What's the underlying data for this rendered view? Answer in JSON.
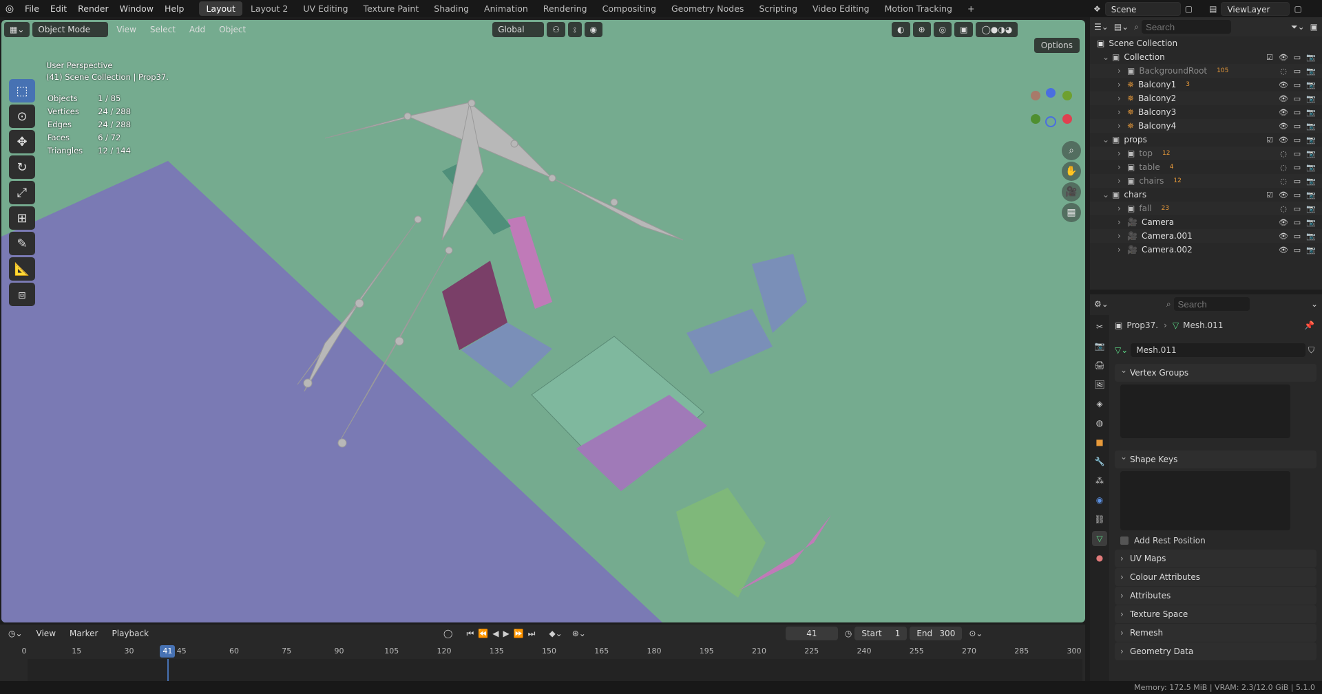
{
  "menu": [
    "File",
    "Edit",
    "Render",
    "Window",
    "Help"
  ],
  "workspaces": [
    "Layout",
    "Layout 2",
    "UV Editing",
    "Texture Paint",
    "Shading",
    "Animation",
    "Rendering",
    "Compositing",
    "Geometry Nodes",
    "Scripting",
    "Video Editing",
    "Motion Tracking"
  ],
  "active_workspace": "Layout",
  "scene_label": "Scene",
  "viewlayer_label": "ViewLayer",
  "viewport": {
    "mode": "Object Mode",
    "menus": [
      "View",
      "Select",
      "Add",
      "Object"
    ],
    "transform_orientation": "Global",
    "options_label": "Options",
    "perspective": "User Perspective",
    "context": "(41) Scene Collection | Prop37.",
    "stats": [
      {
        "label": "Objects",
        "value": "1 / 85"
      },
      {
        "label": "Vertices",
        "value": "24 / 288"
      },
      {
        "label": "Edges",
        "value": "24 / 288"
      },
      {
        "label": "Faces",
        "value": "6 / 72"
      },
      {
        "label": "Triangles",
        "value": "12 / 144"
      }
    ],
    "gizmo": {
      "z": "Z",
      "y": "Y",
      "x": "X"
    },
    "bg_color": "#75ab8f",
    "floor_color": "#7a7ab4"
  },
  "outliner": {
    "search_placeholder": "Search",
    "scene_collection": "Scene Collection",
    "rows": [
      {
        "name": "Collection",
        "type": "collection"
      },
      {
        "name": "BackgroundRoot",
        "type": "object",
        "extra": "105"
      },
      {
        "name": "Balcony1",
        "type": "armature",
        "extra": "3"
      },
      {
        "name": "Balcony2",
        "type": "armature"
      },
      {
        "name": "Balcony3",
        "type": "armature"
      },
      {
        "name": "Balcony4",
        "type": "armature"
      },
      {
        "name": "props",
        "type": "collection"
      },
      {
        "name": "top",
        "type": "object",
        "extra": "12"
      },
      {
        "name": "table",
        "type": "object",
        "extra": "4"
      },
      {
        "name": "chairs",
        "type": "object",
        "extra": "12"
      },
      {
        "name": "chars",
        "type": "collection"
      },
      {
        "name": "fall",
        "type": "object",
        "extra": "23"
      },
      {
        "name": "Camera",
        "type": "camera"
      },
      {
        "name": "Camera.001",
        "type": "camera"
      },
      {
        "name": "Camera.002",
        "type": "camera"
      }
    ]
  },
  "properties": {
    "search_placeholder": "Search",
    "breadcrumb_object": "Prop37.",
    "breadcrumb_mesh": "Mesh.011",
    "mesh_name": "Mesh.011",
    "panels": {
      "vertex_groups": "Vertex Groups",
      "shape_keys": "Shape Keys",
      "add_rest_position": "Add Rest Position",
      "uv_maps": "UV Maps",
      "colour_attributes": "Colour Attributes",
      "attributes": "Attributes",
      "texture_space": "Texture Space",
      "remesh": "Remesh",
      "geometry_data": "Geometry Data"
    }
  },
  "timeline": {
    "menus": [
      "View",
      "Marker",
      "Playback"
    ],
    "current_frame": "41",
    "start_label": "Start",
    "start": "1",
    "end_label": "End",
    "end": "300",
    "ticks": [
      "0",
      "15",
      "30",
      "45",
      "60",
      "75",
      "90",
      "105",
      "120",
      "135",
      "150",
      "165",
      "180",
      "195",
      "210",
      "225",
      "240",
      "255",
      "270",
      "285",
      "300"
    ]
  },
  "status": "Memory: 172.5 MiB | VRAM: 2.3/12.0 GiB | 5.1.0"
}
